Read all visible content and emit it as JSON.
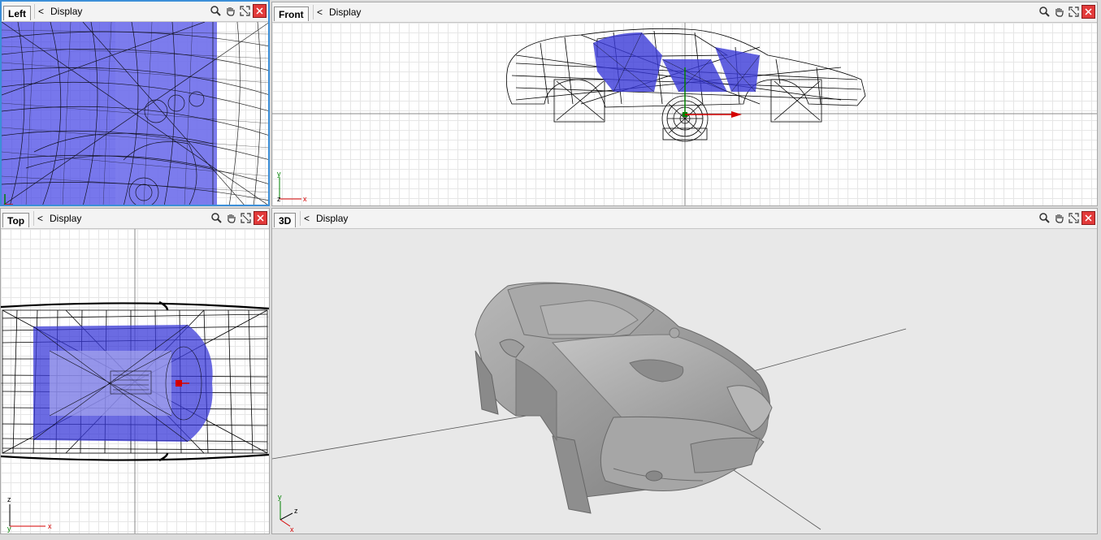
{
  "viewports": {
    "left": {
      "tab_label": "Left",
      "display_label": "Display",
      "back_glyph": "<"
    },
    "front": {
      "tab_label": "Front",
      "display_label": "Display",
      "back_glyph": "<"
    },
    "top": {
      "tab_label": "Top",
      "display_label": "Display",
      "back_glyph": "<"
    },
    "three_d": {
      "tab_label": "3D",
      "display_label": "Display",
      "back_glyph": "<"
    }
  },
  "axes": {
    "x": "x",
    "y": "y",
    "z": "z"
  },
  "toolbar_icons": [
    "zoom-icon",
    "pan-hand-icon",
    "fit-view-icon",
    "close-viewport-icon"
  ],
  "colors": {
    "active_border": "#3c8fd8",
    "wire_blue": "#2a2ad0",
    "wire_black": "#000000",
    "x_axis": "#d40000",
    "y_axis": "#008000",
    "close_button": "#e23a3a"
  }
}
